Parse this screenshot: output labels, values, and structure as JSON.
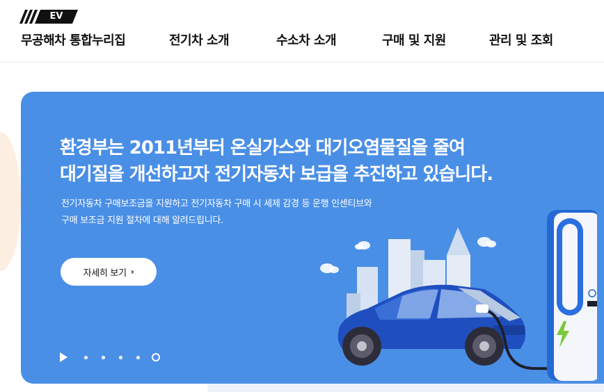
{
  "header": {
    "logo_badge": "EV",
    "site_title": "무공해차 통합누리집",
    "nav": [
      {
        "label": "전기차 소개"
      },
      {
        "label": "수소차 소개"
      },
      {
        "label": "구매 및 지원"
      },
      {
        "label": "관리 및 조회"
      }
    ]
  },
  "hero": {
    "title_line1": "환경부는 2011년부터 온실가스와 대기오염물질을 줄여",
    "title_line2": "대기질을 개선하고자 전기자동차 보급을 추진하고 있습니다.",
    "desc_line1": "전기자동차 구매보조금을 지원하고 전기자동차 구매 시 세제 감경 등 운행 인센티브와",
    "desc_line2": "구매 보조금 지원 절차에 대해 알려드립니다.",
    "button_label": "자세히 보기",
    "button_icon": "chevron-right-icon",
    "slides": {
      "count": 5,
      "active_index": 5
    }
  },
  "colors": {
    "hero_bg": "#4a8fe6",
    "car_body": "#1f4fbf",
    "charger": "#2468d4",
    "bolt": "#7bc93b"
  }
}
